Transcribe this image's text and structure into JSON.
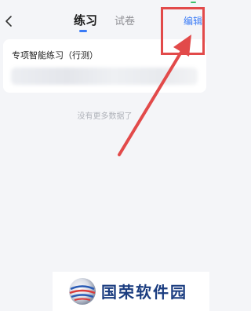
{
  "nav": {
    "back_icon": "chevron-left-icon",
    "tabs": [
      {
        "label": "练习",
        "active": true
      },
      {
        "label": "试卷",
        "active": false
      }
    ],
    "edit_label": "编辑"
  },
  "card": {
    "title": "专项智能练习（行测）"
  },
  "empty_text": "没有更多数据了",
  "annotation": {
    "color": "#e24a4a"
  },
  "watermark": {
    "text": "国荣软件园"
  },
  "colors": {
    "accent": "#3a7bf6",
    "background": "#f4f5f8"
  }
}
